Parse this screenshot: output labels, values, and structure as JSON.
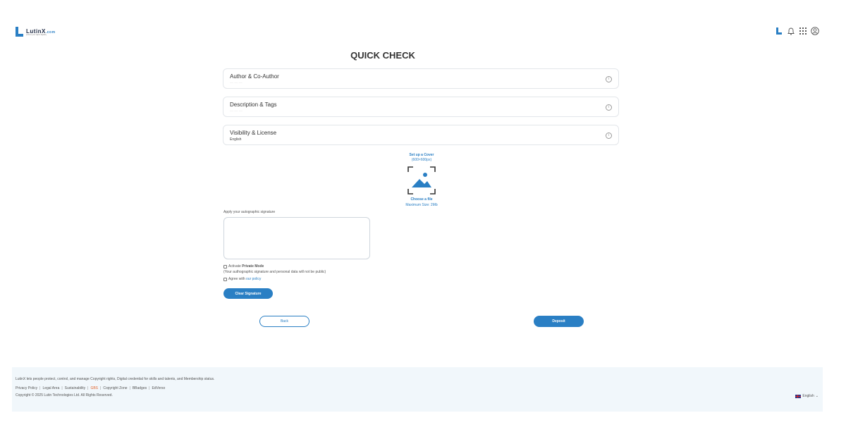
{
  "brand": {
    "name": "LutinX",
    "tld": ".com",
    "tagline": "protect your rights digitally",
    "accent_color": "#2a7fc4"
  },
  "header": {
    "icons": [
      "lutinx-mark-icon",
      "bell-icon",
      "apps-grid-icon",
      "user-profile-icon"
    ]
  },
  "page": {
    "title": "QUICK CHECK"
  },
  "panels": [
    {
      "title": "Author & Co-Author",
      "subtitle": "— — —"
    },
    {
      "title": "Description & Tags",
      "subtitle": "— — —"
    },
    {
      "title": "Visibility & License",
      "subtitle": "English"
    }
  ],
  "cover": {
    "title": "Set up a Cover",
    "size": "(600×600px)",
    "choose": "Choose a file",
    "max": "Maximum Size: 2Mb"
  },
  "signature": {
    "label": "Apply your autographic signature",
    "private_prefix": "Activate ",
    "private_bold": "Private Mode",
    "private_note": "(Your authographic signature and personal data will not be public)",
    "agree_prefix": "Agree with ",
    "agree_link": "our policy",
    "clear_label": "Clear Signature"
  },
  "actions": {
    "back": "Back",
    "deposit": "Deposit"
  },
  "footer": {
    "tagline": "LutinX lets people protect, control, and manage Copyright rights, Digital credential for skills and talents, and Membership status.",
    "links": [
      "Privacy Policy",
      "Legal Area",
      "Sustainability",
      "GBS",
      "Copyright Zone",
      "BBadges",
      "EdVerso"
    ],
    "copyright": "Copyright © 2025 Lutin Technologies Ltd. All Rights Reserved.",
    "language": "English"
  }
}
